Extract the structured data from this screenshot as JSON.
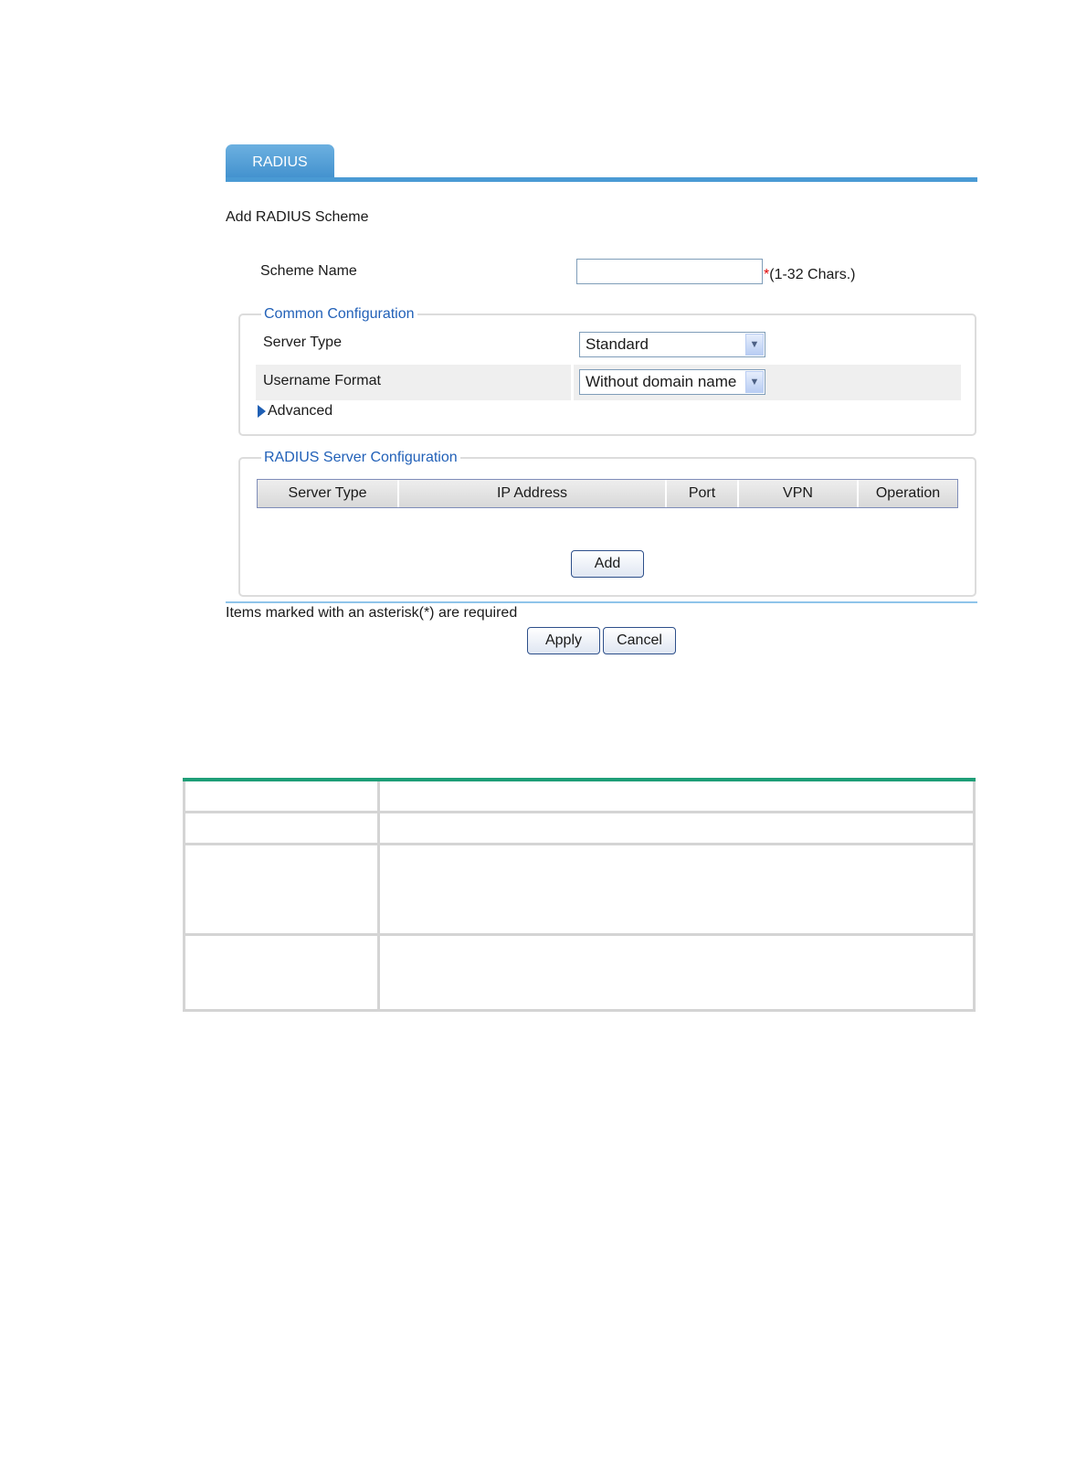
{
  "tab": {
    "label": "RADIUS"
  },
  "page_title": "Add RADIUS Scheme",
  "scheme_name": {
    "label": "Scheme Name",
    "value": "",
    "required_mark": "*",
    "hint": "(1-32 Chars.)"
  },
  "common_config": {
    "legend": "Common Configuration",
    "server_type": {
      "label": "Server Type",
      "value": "Standard"
    },
    "username_format": {
      "label": "Username Format",
      "value": "Without domain name"
    },
    "advanced_label": "Advanced"
  },
  "server_config": {
    "legend": "RADIUS Server Configuration",
    "columns": [
      "Server Type",
      "IP Address",
      "Port",
      "VPN",
      "Operation"
    ],
    "add_label": "Add"
  },
  "footer": {
    "required_note": "Items marked with an asterisk(*) are required",
    "apply_label": "Apply",
    "cancel_label": "Cancel"
  },
  "colors": {
    "tab_blue": "#4a9ad4",
    "legend_blue": "#2261b8",
    "required_red": "#e00000",
    "doc_table_accent": "#1e9e77"
  },
  "icons": {
    "dropdown": "chevron-down-icon",
    "expand": "triangle-right-icon"
  }
}
